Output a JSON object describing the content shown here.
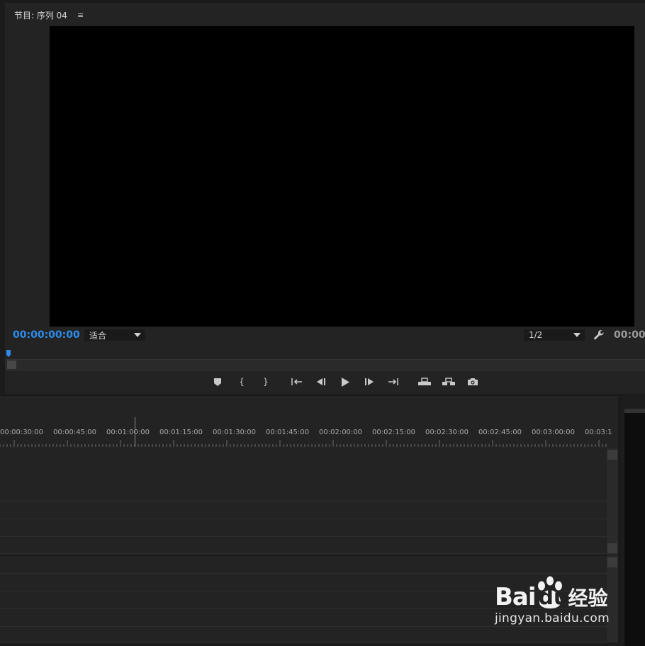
{
  "program_monitor": {
    "tab_title": "节目: 序列 04",
    "menu_icon": "≡",
    "timecode_current": "00:00:00:00",
    "timecode_duration": "00:00:",
    "fit_dropdown": {
      "selected": "适合"
    },
    "resolution_dropdown": {
      "selected": "1/2"
    },
    "accent_color": "#2d8ceb",
    "transport_buttons": [
      {
        "name": "add-marker",
        "icon": "marker-icon"
      },
      {
        "name": "mark-in",
        "icon": "mark-in-icon",
        "glyph": "{"
      },
      {
        "name": "mark-out",
        "icon": "mark-out-icon",
        "glyph": "}"
      },
      {
        "name": "go-to-in",
        "icon": "go-to-in-icon"
      },
      {
        "name": "step-back",
        "icon": "step-back-icon"
      },
      {
        "name": "play",
        "icon": "play-icon"
      },
      {
        "name": "step-forward",
        "icon": "step-forward-icon"
      },
      {
        "name": "go-to-out",
        "icon": "go-to-out-icon"
      },
      {
        "name": "lift",
        "icon": "lift-icon"
      },
      {
        "name": "extract",
        "icon": "extract-icon"
      },
      {
        "name": "export-frame",
        "icon": "camera-icon"
      }
    ]
  },
  "timeline": {
    "ruler_labels": [
      "00:00:30:00",
      "00:00:45:00",
      "00:01:00:00",
      "00:01:15:00",
      "00:01:30:00",
      "00:01:45:00",
      "00:02:00:00",
      "00:02:15:00",
      "00:02:30:00",
      "00:02:45:00",
      "00:03:00:00",
      "00:03:1"
    ]
  },
  "watermark": {
    "logo_text_left": "Bai",
    "logo_text_right": "du",
    "logo_suffix": "经验",
    "url": "jingyan.baidu.com"
  }
}
